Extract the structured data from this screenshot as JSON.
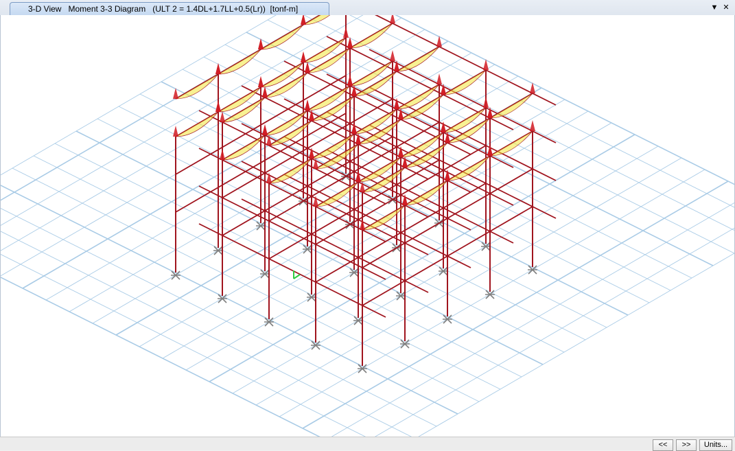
{
  "tab": {
    "view_name": "3-D View",
    "diagram": "Moment 3-3 Diagram",
    "combo": "(ULT 2 = 1.4DL+1.7LL+0.5(Lr))",
    "units": "[tonf-m]"
  },
  "window": {
    "dropdown_icon": "chevron-down-icon",
    "close_icon": "close-icon",
    "dropdown_glyph": "▼",
    "close_glyph": "✕"
  },
  "status": {
    "prev_label": "<<",
    "next_label": ">>",
    "units_label": "Units..."
  },
  "colors": {
    "grid": "#a9cbe6",
    "frame": "#a0141e",
    "moment_positive": "#f2e53a",
    "moment_negative": "#d11a22",
    "support": "#808080"
  }
}
